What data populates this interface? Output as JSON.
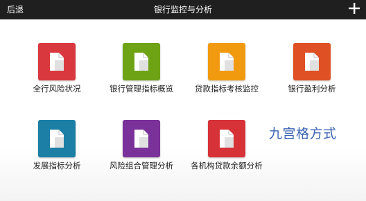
{
  "header": {
    "back_label": "后退",
    "title": "银行监控与分析",
    "add_icon": "plus-icon"
  },
  "tiles": [
    {
      "label": "全行风险状况",
      "color": "#d9393e",
      "icon": "document-icon"
    },
    {
      "label": "银行管理指标概览",
      "color": "#6ea315",
      "icon": "document-icon"
    },
    {
      "label": "贷款指标考核监控",
      "color": "#f29a0f",
      "icon": "document-icon"
    },
    {
      "label": "银行盈利分析",
      "color": "#df5024",
      "icon": "document-icon"
    },
    {
      "label": "发展指标分析",
      "color": "#1c7fa6",
      "icon": "document-icon"
    },
    {
      "label": "风险组合管理分析",
      "color": "#7a3199",
      "icon": "document-icon"
    },
    {
      "label": "各机构贷款余额分析",
      "color": "#d63238",
      "icon": "document-icon"
    }
  ],
  "note": "九宫格方式"
}
